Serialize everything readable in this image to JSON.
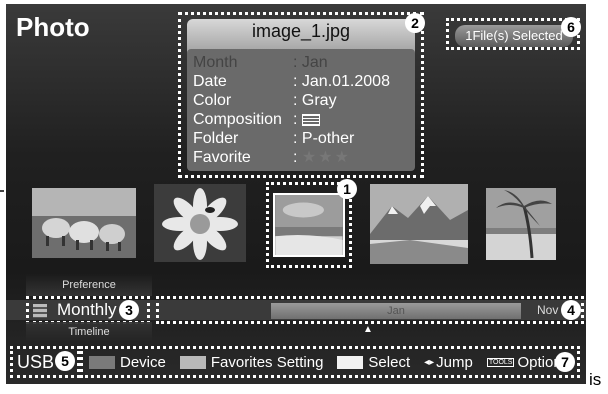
{
  "screen": {
    "title": "Photo"
  },
  "info": {
    "filename": "image_1.jpg",
    "rows": [
      {
        "key": "Month",
        "value": ": Jan",
        "dim": true
      },
      {
        "key": "Date",
        "value": ": Jan.01.2008"
      },
      {
        "key": "Color",
        "value": ": Gray"
      },
      {
        "key": "Composition",
        "value": ":"
      },
      {
        "key": "Folder",
        "value": ": P-other"
      },
      {
        "key": "Favorite",
        "value": ":"
      }
    ],
    "stars": "★★★"
  },
  "selection": {
    "label": "1File(s) Selected"
  },
  "thumbnails": [
    {
      "name": "thumb-sheep"
    },
    {
      "name": "thumb-flower"
    },
    {
      "name": "thumb-beach",
      "selected": true
    },
    {
      "name": "thumb-mountain"
    },
    {
      "name": "thumb-palm"
    }
  ],
  "sort": {
    "preference": "Preference",
    "current": "Monthly",
    "timeline": "Timeline"
  },
  "timeline": {
    "current_month": "Jan",
    "next_month": "Nov"
  },
  "footer": {
    "source": "USB",
    "items": [
      {
        "key_color": "#7a7a7a",
        "label": "Device"
      },
      {
        "key_color": "#b8b8b8",
        "label": "Favorites Setting"
      },
      {
        "key_color": "#f2f2f2",
        "label": "Select"
      },
      {
        "icon": "◂▸",
        "label": "Jump"
      },
      {
        "icon": "TOOLS",
        "label": "Option"
      }
    ]
  },
  "callouts": [
    "1",
    "2",
    "3",
    "4",
    "5",
    "6",
    "7"
  ],
  "caption": "is"
}
